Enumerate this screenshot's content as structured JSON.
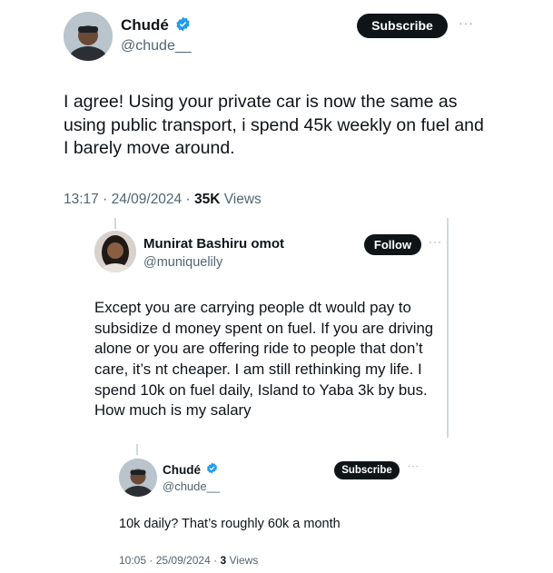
{
  "main_tweet": {
    "display_name": "Chudé",
    "handle": "@chude__",
    "subscribe_label": "Subscribe",
    "more_label": "···",
    "text": "I agree! Using your private car is now the same as using public transport, i spend 45k weekly on fuel and I barely move around.",
    "time": "13:17",
    "date": "24/09/2024",
    "views_count": "35K",
    "views_label": "Views",
    "separator": "·"
  },
  "quoted_tweet": {
    "display_name": "Munirat Bashiru omot",
    "handle": "@muniquelily",
    "follow_label": "Follow",
    "more_label": "···",
    "text": "Except you are carrying people dt would pay to subsidize d money spent on fuel. If you are driving alone or you are offering ride to people that don’t care, it’s nt cheaper. I am still rethinking my life. I spend 10k on fuel daily, Island to Yaba 3k by bus. How much is my salary"
  },
  "reply_tweet": {
    "display_name": "Chudé",
    "handle": "@chude__",
    "subscribe_label": "Subscribe",
    "more_label": "···",
    "text": "10k daily? That’s roughly 60k a month",
    "time": "10:05",
    "date": "25/09/2024",
    "views_count": "3",
    "views_label": "Views",
    "separator": "·"
  },
  "colors": {
    "verified": "#1d9bf0",
    "text": "#0f1419",
    "secondary": "#536471",
    "button_bg": "#0f1419"
  }
}
